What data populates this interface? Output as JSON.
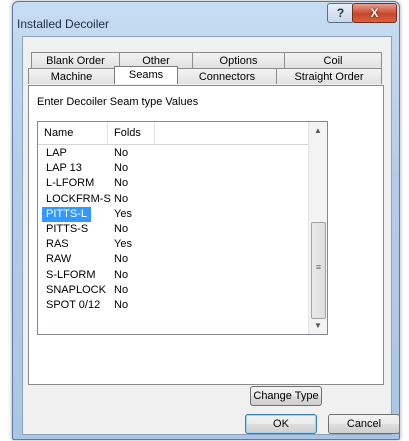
{
  "window": {
    "title": "Installed Decoiler",
    "help_label": "?",
    "close_label": "X"
  },
  "tabs_row1": [
    "Blank Order",
    "Other",
    "Options",
    "Coil"
  ],
  "tabs_row2": [
    "Machine",
    "Seams",
    "Connectors",
    "Straight Order"
  ],
  "active_tab": "Seams",
  "prompt": "Enter Decoiler Seam type Values",
  "list": {
    "columns": [
      "Name",
      "Folds"
    ],
    "rows": [
      [
        "LAP",
        "No"
      ],
      [
        "LAP 13",
        "No"
      ],
      [
        "L-LFORM",
        "No"
      ],
      [
        "LOCKFRM-S",
        "No"
      ],
      [
        "PITTS-L",
        "Yes"
      ],
      [
        "PITTS-S",
        "No"
      ],
      [
        "RAS",
        "Yes"
      ],
      [
        "RAW",
        "No"
      ],
      [
        "S-LFORM",
        "No"
      ],
      [
        "SNAPLOCK",
        "No"
      ],
      [
        "SPOT 0/12",
        "No"
      ]
    ],
    "selected": "PITTS-L"
  },
  "buttons": {
    "change_type": "Change Type",
    "ok": "OK",
    "cancel": "Cancel"
  },
  "icons": {
    "scroll_up": "▲",
    "scroll_down": "▼",
    "grip": "≡"
  }
}
